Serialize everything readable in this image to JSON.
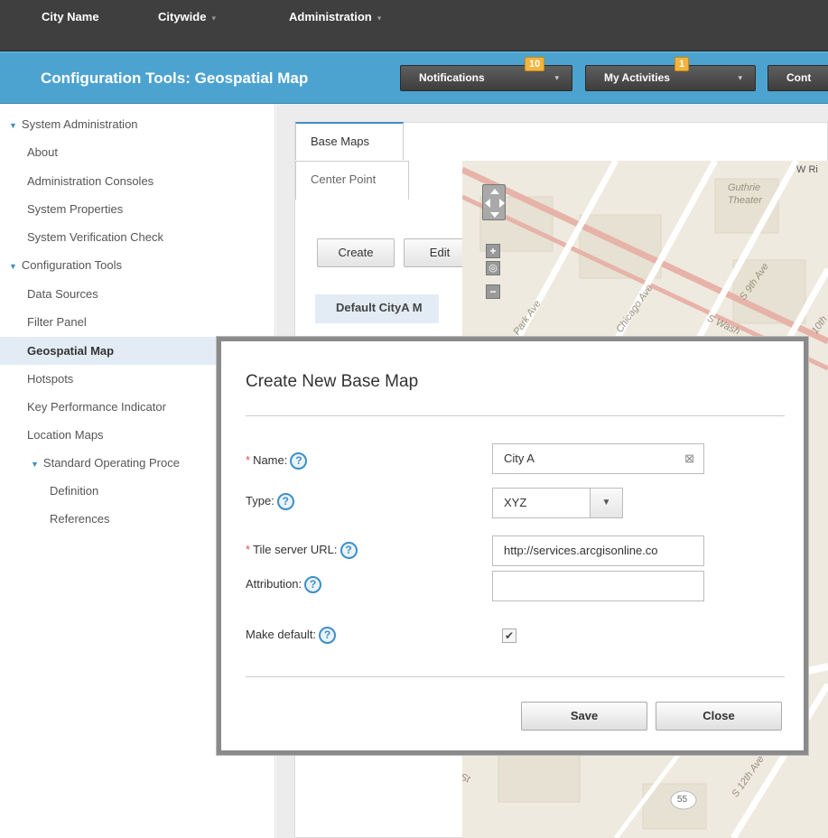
{
  "topbar": {
    "city": "City Name",
    "citywide": "Citywide",
    "administration": "Administration",
    "caret": "▾"
  },
  "header": {
    "title": "Configuration Tools: Geospatial Map",
    "notifications": {
      "label": "Notifications",
      "count": "10"
    },
    "activities": {
      "label": "My Activities",
      "count": "1"
    },
    "cont": "Cont"
  },
  "sidebar": {
    "items": [
      {
        "label": "System Administration",
        "level": 0,
        "expanded": true
      },
      {
        "label": "About",
        "level": 1
      },
      {
        "label": "Administration Consoles",
        "level": 1
      },
      {
        "label": "System Properties",
        "level": 1
      },
      {
        "label": "System Verification Check",
        "level": 1
      },
      {
        "label": "Configuration Tools",
        "level": 0,
        "expanded": true
      },
      {
        "label": "Data Sources",
        "level": 1
      },
      {
        "label": "Filter Panel",
        "level": 1
      },
      {
        "label": "Geospatial Map",
        "level": 1,
        "active": true
      },
      {
        "label": "Hotspots",
        "level": 1
      },
      {
        "label": "Key Performance Indicator",
        "level": 1
      },
      {
        "label": "Location Maps",
        "level": 1
      },
      {
        "label": "Standard Operating Proce",
        "level": 1,
        "expanded": true
      },
      {
        "label": "Definition",
        "level": 2
      },
      {
        "label": "References",
        "level": 2
      }
    ]
  },
  "content": {
    "tabs": {
      "base_maps": "Base Maps",
      "center_point": "Center Point"
    },
    "create": "Create",
    "edit": "Edit",
    "default_item": "Default CityA M"
  },
  "map": {
    "labels": {
      "guthrie": "Guthrie",
      "theater": "Theater",
      "wri": "W Ri",
      "park": "Park Ave",
      "chicago": "Chicago Ave",
      "s9th": "S 9th Ave",
      "swash": "S Wash",
      "tenth": "10th",
      "th_st": "th St",
      "s12th": "S 12th Ave",
      "route": "55"
    }
  },
  "modal": {
    "title": "Create New Base Map",
    "name_label": "Name:",
    "name_value": "City A",
    "type_label": "Type:",
    "type_value": "XYZ",
    "url_label": "Tile server URL:",
    "url_value": "http://services.arcgisonline.co",
    "attribution_label": "Attribution:",
    "attribution_value": "",
    "default_label": "Make default:",
    "default_checked": true,
    "save": "Save",
    "close": "Close",
    "req_mark": "*",
    "help_glyph": "?"
  },
  "colors": {
    "topbar": "#3f3f3f",
    "header": "#4da3d0",
    "accent": "#3d8fc6",
    "badge": "#f3b33d"
  }
}
